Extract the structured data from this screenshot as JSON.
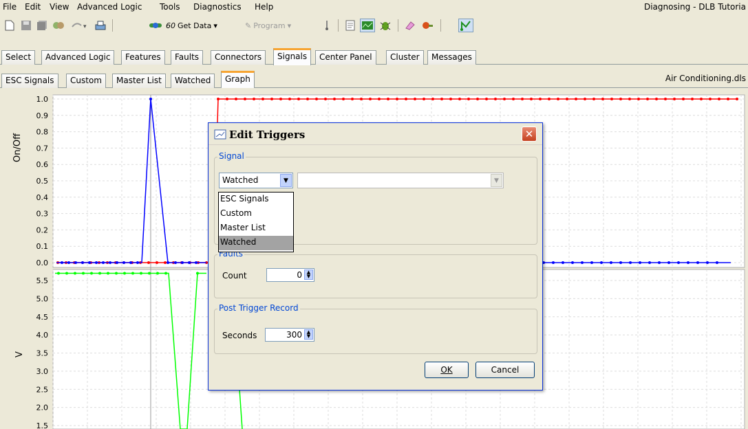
{
  "menu": [
    "File",
    "Edit",
    "View",
    "Advanced Logic",
    "Tools",
    "Diagnostics",
    "Help"
  ],
  "window_title": "Diagnosing - DLB Tutoria",
  "toolbar": {
    "get_data": "Get Data",
    "program": "Program"
  },
  "main_tabs": [
    "Select",
    "Advanced Logic",
    "Features",
    "Faults",
    "Connectors",
    "Signals",
    "Center Panel",
    "Cluster",
    "Messages"
  ],
  "main_active_tab": "Signals",
  "sub_tabs": [
    "ESC Signals",
    "Custom",
    "Master List",
    "Watched",
    "Graph"
  ],
  "sub_active_tab": "Graph",
  "file_label": "Air Conditioning.dls",
  "chart_data": [
    {
      "type": "line",
      "ylabel": "On/Off",
      "ylim": [
        0.0,
        1.0
      ],
      "yticks": [
        "1.0",
        "0.9",
        "0.8",
        "0.7",
        "0.6",
        "0.5",
        "0.4",
        "0.3",
        "0.2",
        "0.1",
        "0.0"
      ],
      "series": [
        {
          "color": "#ff0000",
          "note_pulse": "steps from 0.0 to 1.0 and stays high"
        },
        {
          "color": "#0000ff",
          "note_pulse": "single spike to 1.0 then 0.0"
        }
      ]
    },
    {
      "type": "line",
      "ylabel": "V",
      "ylim": [
        1.5,
        5.5
      ],
      "yticks": [
        "5.5",
        "5.0",
        "4.5",
        "4.0",
        "3.5",
        "3.0",
        "2.5",
        "2.0",
        "1.5"
      ],
      "series": [
        {
          "color": "#00ff00"
        }
      ]
    }
  ],
  "dialog": {
    "title": "Edit Triggers",
    "signal_group": "Signal",
    "signal_select": "Watched",
    "signal_options": [
      "ESC Signals",
      "Custom",
      "Master List",
      "Watched"
    ],
    "faults_group": "Faults",
    "count_label": "Count",
    "count_value": "0",
    "post_group": "Post Trigger Record",
    "seconds_label": "Seconds",
    "seconds_value": "300",
    "ok": "OK",
    "cancel": "Cancel"
  }
}
